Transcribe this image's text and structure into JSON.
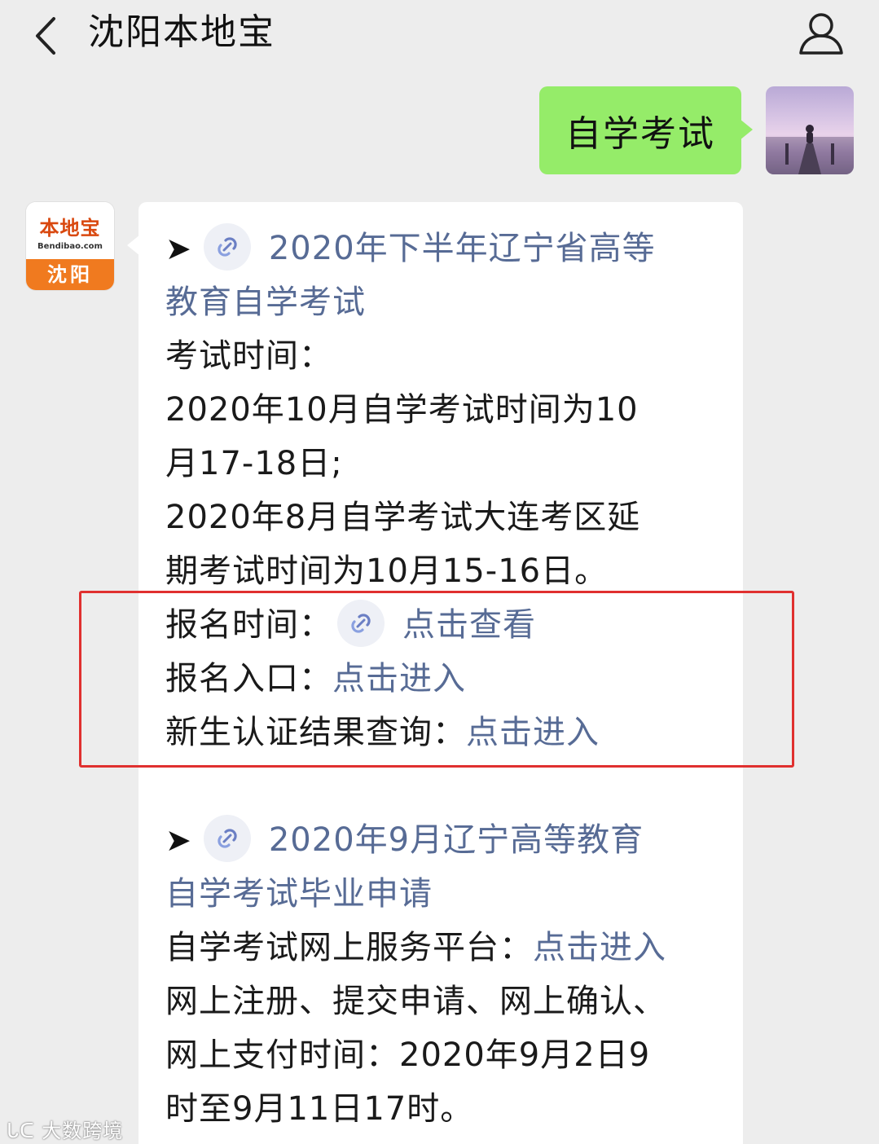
{
  "header": {
    "title": "沈阳本地宝"
  },
  "outgoing_message": {
    "text": "自学考试"
  },
  "bot_avatar": {
    "logo": "本地宝",
    "sub": "Bendibao.com",
    "city": "沈阳"
  },
  "incoming_message": {
    "lines": {
      "l1": "2020年下半年辽宁省高等",
      "l2": "教育自学考试",
      "l3": "考试时间：",
      "l4": "2020年10月自学考试时间为10",
      "l5": "月17-18日;",
      "l6": "2020年8月自学考试大连考区延",
      "l7": "期考试时间为10月15-16日。",
      "l8_label": "报名时间：",
      "l8_link": "点击查看",
      "l9_label": "报名入口：",
      "l9_link": "点击进入",
      "l10_label": "新生认证结果查询：",
      "l10_link": "点击进入",
      "l11": "2020年9月辽宁高等教育",
      "l12": "自学考试毕业申请",
      "l13_label": "自学考试网上服务平台：",
      "l13_link": "点击进入",
      "l14": "网上注册、提交申请、网上确认、",
      "l15": "网上支付时间：2020年9月2日9",
      "l16": "时至9月11日17时。"
    },
    "arrow_glyph": "➤"
  },
  "watermark": "大数跨境",
  "colors": {
    "background": "#ededed",
    "outgoing_bubble": "#95ec69",
    "link": "#576b95",
    "highlight_border": "#e0302f"
  }
}
